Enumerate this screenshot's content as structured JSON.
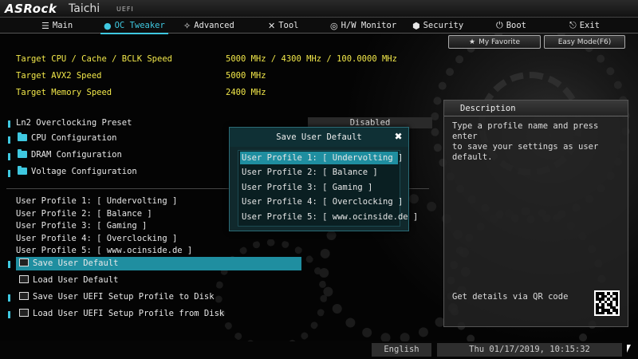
{
  "header": {
    "brand": "ASRock",
    "model": "Taichi",
    "firmware": "UEFI"
  },
  "menu": [
    {
      "label": "Main",
      "icon": "list-icon",
      "active": false
    },
    {
      "label": "OC Tweaker",
      "icon": "flame-icon",
      "active": true
    },
    {
      "label": "Advanced",
      "icon": "star-icon",
      "active": false
    },
    {
      "label": "Tool",
      "icon": "tools-icon",
      "active": false
    },
    {
      "label": "H/W Monitor",
      "icon": "monitor-icon",
      "active": false
    },
    {
      "label": "Security",
      "icon": "shield-icon",
      "active": false
    },
    {
      "label": "Boot",
      "icon": "power-icon",
      "active": false
    },
    {
      "label": "Exit",
      "icon": "exit-icon",
      "active": false
    }
  ],
  "buttons": {
    "favorite": "My Favorite",
    "easy_mode": "Easy Mode(F6)"
  },
  "info": [
    {
      "label": "Target CPU / Cache / BCLK Speed",
      "value": "5000 MHz / 4300 MHz / 100.0000 MHz"
    },
    {
      "label": "Target AVX2 Speed",
      "value": "5000 MHz"
    },
    {
      "label": "Target Memory Speed",
      "value": "2400 MHz"
    }
  ],
  "preset": {
    "label": "Ln2 Overclocking Preset",
    "value": "Disabled"
  },
  "folders": [
    "CPU Configuration",
    "DRAM Configuration",
    "Voltage Configuration"
  ],
  "profiles": [
    "User Profile 1: [ Undervolting ]",
    "User Profile 2: [ Balance ]",
    "User Profile 3: [ Gaming ]",
    "User Profile 4: [ Overclocking ]",
    "User Profile 5: [ www.ocinside.de ]"
  ],
  "actions": [
    "Save User Default",
    "Load User Default",
    "Save User UEFI Setup Profile to Disk",
    "Load User UEFI Setup Profile from Disk"
  ],
  "description": {
    "title": "Description",
    "text": "Type a profile name and press enter\nto save your settings as user default.",
    "qr_label": "Get details via QR code"
  },
  "modal": {
    "title": "Save User Default",
    "selected_index": 0,
    "items": [
      "User Profile 1: [ Undervolting ]",
      "User Profile 2: [ Balance ]",
      "User Profile 3: [ Gaming ]",
      "User Profile 4: [ Overclocking ]",
      "User Profile 5: [ www.ocinside.de ]"
    ]
  },
  "footer": {
    "language": "English",
    "datetime": "Thu 01/17/2019, 10:15:32"
  },
  "colors": {
    "accent": "#3fc8e0",
    "highlight": "#1f8ea0",
    "info_text": "#f2e84a"
  }
}
